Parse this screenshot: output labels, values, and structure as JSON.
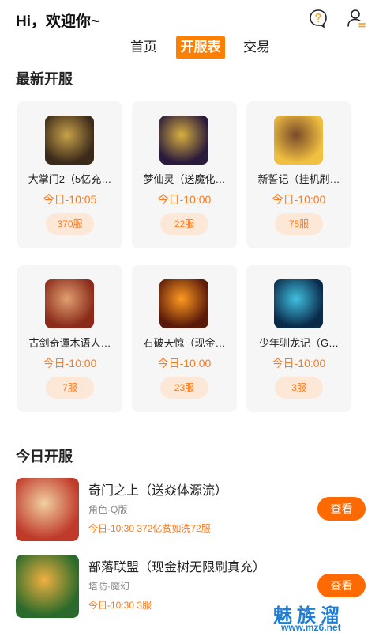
{
  "header": {
    "greeting": "Hi，欢迎你~",
    "icons": [
      "help-icon",
      "user-icon"
    ]
  },
  "tabs": [
    {
      "label": "首页",
      "active": false
    },
    {
      "label": "开服表",
      "active": true
    },
    {
      "label": "交易",
      "active": false
    }
  ],
  "latest": {
    "title": "最新开服",
    "cards": [
      {
        "name": "大掌门2（5亿充…",
        "time": "今日-10:05",
        "servers": "370服",
        "thumb_colors": [
          "#3b2a1a",
          "#c9a24a"
        ]
      },
      {
        "name": "梦仙灵（送魔化…",
        "time": "今日-10:00",
        "servers": "22服",
        "thumb_colors": [
          "#2a1a3b",
          "#d8b040"
        ]
      },
      {
        "name": "新誓记（挂机刷…",
        "time": "今日-10:00",
        "servers": "75服",
        "thumb_colors": [
          "#f0c040",
          "#7a4a2a"
        ]
      },
      {
        "name": "古剑奇谭木语人…",
        "time": "今日-10:00",
        "servers": "7服",
        "thumb_colors": [
          "#8a2a1a",
          "#e0a070"
        ]
      },
      {
        "name": "石破天惊（现金…",
        "time": "今日-10:00",
        "servers": "23服",
        "thumb_colors": [
          "#5a1a0a",
          "#ff9a20"
        ]
      },
      {
        "name": "少年驯龙记（G…",
        "time": "今日-10:00",
        "servers": "3服",
        "thumb_colors": [
          "#0a2a4a",
          "#40c0e0"
        ]
      }
    ]
  },
  "today": {
    "title": "今日开服",
    "items": [
      {
        "name": "奇门之上（送焱体源流）",
        "category": "角色·Q版",
        "info": "今日-10:30 372亿贫如洗72服",
        "button": "查看",
        "thumb_colors": [
          "#c03a2a",
          "#f0d0a0"
        ]
      },
      {
        "name": "部落联盟（现金树无限刷真充）",
        "category": "塔防·魔幻",
        "info": "今日-10:30 3服",
        "button": "查看",
        "thumb_colors": [
          "#2a6a2a",
          "#f0b040"
        ]
      }
    ]
  },
  "watermark": {
    "text": "魅族溜",
    "url": "www.mz6.net"
  }
}
